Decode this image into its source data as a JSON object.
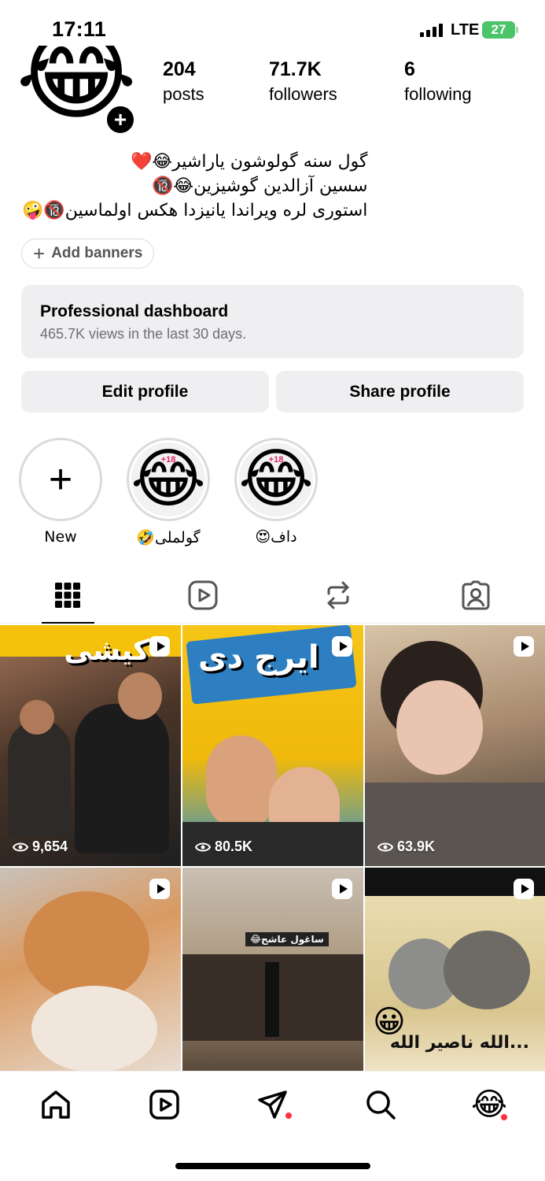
{
  "status_bar": {
    "time": "17:11",
    "network": "LTE",
    "battery": "27"
  },
  "profile": {
    "avatar_emoji": "😂",
    "stats": [
      {
        "value": "204",
        "label": "posts"
      },
      {
        "value": "71.7K",
        "label": "followers"
      },
      {
        "value": "6",
        "label": "following"
      }
    ],
    "bio": [
      "گول سنه گولوشون یاراشیر😂❤️",
      "سسین آزالدین گوشیزین😂🔞",
      "استوری لره ویراندا یانیزدا هکس اولماسین🔞🤪"
    ],
    "add_banners_label": "Add banners",
    "dashboard": {
      "title": "Professional dashboard",
      "subtitle": "465.7K views in the last 30 days."
    },
    "edit_profile_label": "Edit profile",
    "share_profile_label": "Share profile"
  },
  "highlights": [
    {
      "label": "New",
      "type": "new"
    },
    {
      "label": "گولملی🤣",
      "emoji": "😂",
      "badge": "+18"
    },
    {
      "label": "داف😍",
      "emoji": "😂",
      "badge": "+18"
    }
  ],
  "tabs": [
    "grid",
    "reels",
    "reposts",
    "tagged"
  ],
  "grid": [
    {
      "views": "9,654",
      "overlay": "کیشی",
      "colors": [
        "#6b4a35",
        "#2b2b2b"
      ]
    },
    {
      "views": "80.5K",
      "overlay": "ایرج دی",
      "colors": [
        "#f5c518",
        "#2d7fc1"
      ]
    },
    {
      "views": "63.9K",
      "overlay": "",
      "colors": [
        "#c9a88a",
        "#3e3a34"
      ]
    },
    {
      "views": "",
      "overlay": "",
      "colors": [
        "#d99a62",
        "#c8b7a7"
      ]
    },
    {
      "views": "",
      "overlay": "ساغول عاشح😂",
      "colors": [
        "#c7bfb4",
        "#6d5d4e"
      ]
    },
    {
      "views": "",
      "overlay": "...الله ناصیر الله",
      "colors": [
        "#e8d9a8",
        "#7b7b7b"
      ]
    }
  ],
  "colors": {
    "notification_dot": "#ff3040",
    "badge_red": "#e0245e"
  },
  "nav": [
    "home-icon",
    "reels-icon",
    "direct-icon",
    "search-icon",
    "profile-avatar"
  ]
}
